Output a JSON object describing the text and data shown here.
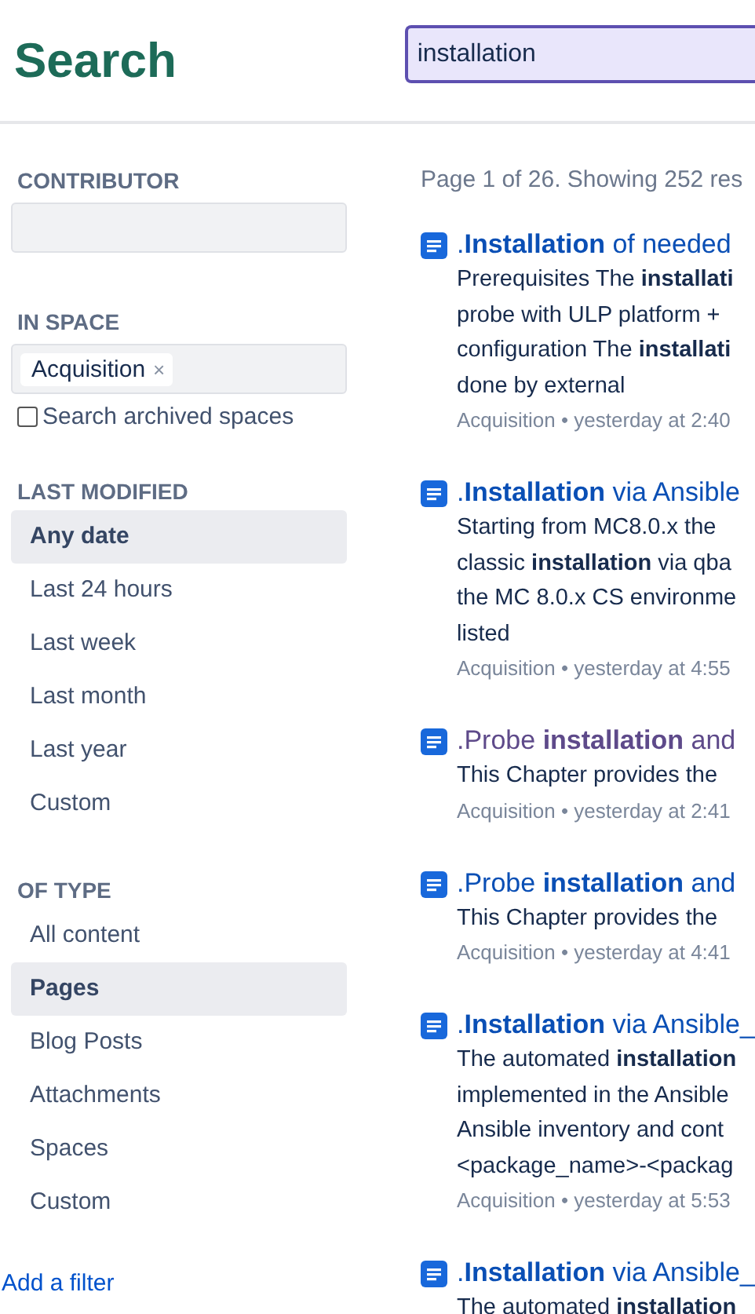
{
  "header": {
    "title": "Search",
    "search": {
      "value": "installation"
    }
  },
  "filters": {
    "contributor": {
      "label": "CONTRIBUTOR"
    },
    "in_space": {
      "label": "IN SPACE",
      "tags": [
        {
          "label": "Acquisition",
          "remove": "×"
        }
      ],
      "archived": {
        "label": "Search archived spaces",
        "checked": false
      }
    },
    "last_modified": {
      "label": "LAST MODIFIED",
      "items": [
        {
          "label": "Any date",
          "selected": true
        },
        {
          "label": "Last 24 hours",
          "selected": false
        },
        {
          "label": "Last week",
          "selected": false
        },
        {
          "label": "Last month",
          "selected": false
        },
        {
          "label": "Last year",
          "selected": false
        },
        {
          "label": "Custom",
          "selected": false
        }
      ]
    },
    "of_type": {
      "label": "OF TYPE",
      "items": [
        {
          "label": "All content",
          "selected": false
        },
        {
          "label": "Pages",
          "selected": true
        },
        {
          "label": "Blog Posts",
          "selected": false
        },
        {
          "label": "Attachments",
          "selected": false
        },
        {
          "label": "Spaces",
          "selected": false
        },
        {
          "label": "Custom",
          "selected": false
        }
      ]
    },
    "add_filter": "Add a filter"
  },
  "summary": "Page 1 of 26. Showing 252 res",
  "results": [
    {
      "title": ".**Installation** of needed",
      "visited": false,
      "snippet": [
        "Prerequisites The **installati**",
        "probe with ULP platform +",
        "configuration The **installati**",
        "done by external"
      ],
      "meta": "Acquisition • yesterday at 2:40"
    },
    {
      "title": ".**Installation** via Ansible",
      "visited": false,
      "snippet": [
        "Starting from MC8.0.x the",
        "classic **installation** via qba",
        "the MC 8.0.x CS environme",
        "listed"
      ],
      "meta": "Acquisition • yesterday at 4:55"
    },
    {
      "title": ".Probe **installation** and",
      "visited": true,
      "snippet": [
        "This Chapter provides the"
      ],
      "meta": "Acquisition • yesterday at 2:41"
    },
    {
      "title": ".Probe **installation** and",
      "visited": false,
      "snippet": [
        "This Chapter provides the"
      ],
      "meta": "Acquisition • yesterday at 4:41"
    },
    {
      "title": ".**Installation** via Ansible_",
      "visited": false,
      "snippet": [
        "The automated **installation**",
        "implemented in the Ansible",
        "Ansible inventory and cont",
        "<package_name>-<packag"
      ],
      "meta": "Acquisition • yesterday at 5:53"
    },
    {
      "title": ".**Installation** via Ansible_",
      "visited": false,
      "snippet": [
        "The automated **installation**"
      ]
    }
  ]
}
